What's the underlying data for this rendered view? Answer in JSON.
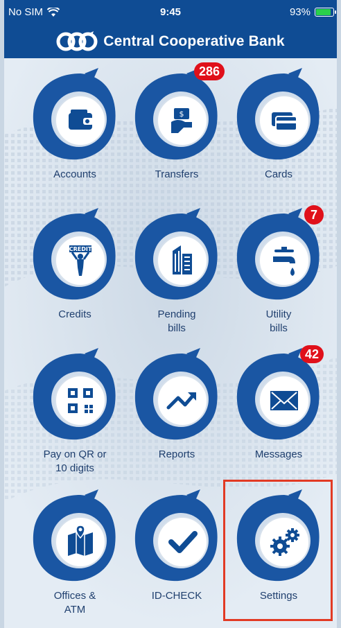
{
  "status_bar": {
    "carrier": "No SIM",
    "time": "9:45",
    "battery": "93%",
    "battery_level": 0.93
  },
  "header": {
    "bank_name": "Central Cooperative Bank",
    "logo_icon": "ccb-logo"
  },
  "colors": {
    "brand": "#0f4c94",
    "badge": "#e0101a",
    "highlight": "#e23a24"
  },
  "menu": [
    {
      "label": "Accounts",
      "icon": "wallet-icon"
    },
    {
      "label": "Transfers",
      "icon": "money-transfer-icon",
      "badge": "286"
    },
    {
      "label": "Cards",
      "icon": "cards-icon"
    },
    {
      "label": "Credits",
      "icon": "credit-person-icon"
    },
    {
      "label": "Pending\nbills",
      "icon": "building-icon"
    },
    {
      "label": "Utility\nbills",
      "icon": "faucet-icon",
      "badge": "7"
    },
    {
      "label": "Pay on QR or\n10 digits",
      "icon": "qr-code-icon"
    },
    {
      "label": "Reports",
      "icon": "trend-arrow-icon"
    },
    {
      "label": "Messages",
      "icon": "envelope-icon",
      "badge": "42"
    },
    {
      "label": "Offices &\nATM",
      "icon": "map-pin-icon"
    },
    {
      "label": "ID-CHECK",
      "icon": "checkmark-icon"
    },
    {
      "label": "Settings",
      "icon": "gears-icon",
      "highlighted": true
    }
  ]
}
